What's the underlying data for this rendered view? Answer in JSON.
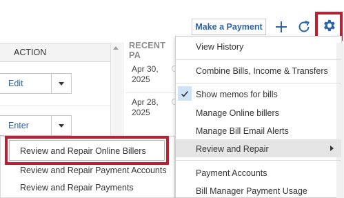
{
  "toolbar": {
    "make_payment_label": "Make a Payment",
    "add_icon": "plus-icon",
    "refresh_icon": "refresh-icon",
    "settings_icon": "gear-icon"
  },
  "table": {
    "action_header": "ACTION",
    "rows": [
      {
        "action_label": "Edit"
      },
      {
        "action_label": "Enter"
      }
    ]
  },
  "recent": {
    "header": "RECENT PA",
    "dates": [
      "Apr 30, 2025",
      "Apr 28, 2025"
    ]
  },
  "submenu": {
    "items": [
      "Review and Repair Online Billers",
      "Review and Repair Payment Accounts",
      "Review and Repair Payments"
    ]
  },
  "menu": {
    "items": [
      "View History",
      "Combine Bills, Income & Transfers",
      "Show memos for bills",
      "Manage Online billers",
      "Manage Bill Email Alerts",
      "Review and Repair",
      "Payment Accounts",
      "Bill Manager Payment Usage"
    ]
  },
  "colors": {
    "highlight_border": "#c01e32",
    "link_blue": "#2b64a8",
    "check_bg": "#cfe3f7"
  }
}
